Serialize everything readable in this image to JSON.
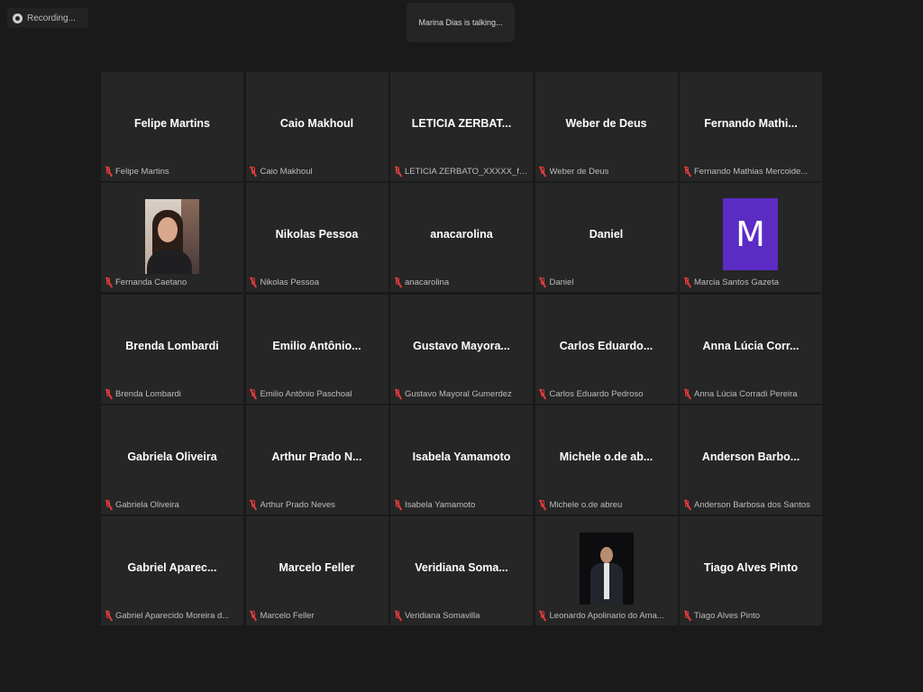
{
  "recording": {
    "label": "Recording...",
    "icon": "recording-icon"
  },
  "talking": {
    "text": "Marina Dias is talking..."
  },
  "colors": {
    "background": "#1a1a1a",
    "tile": "#262626",
    "mic_muted": "#e23b3b",
    "avatar_purple": "#5b2bc4"
  },
  "participants": [
    {
      "display": "Felipe Martins",
      "label": "Felipe Martins"
    },
    {
      "display": "Caio Makhoul",
      "label": "Caio Makhoul"
    },
    {
      "display": "LETICIA ZERBAT...",
      "label": "LETICIA ZERBATO_XXXXX_feli..."
    },
    {
      "display": "Weber de Deus",
      "label": "Weber de Deus"
    },
    {
      "display": "Fernando  Mathi...",
      "label": "Fernando Mathias Mercoide..."
    },
    {
      "display": "",
      "label": "Fernanda Caetano",
      "video": "photo-woman"
    },
    {
      "display": "Nikolas Pessoa",
      "label": "Nikolas Pessoa"
    },
    {
      "display": "anacarolina",
      "label": "anacarolina"
    },
    {
      "display": "Daniel",
      "label": "Daniel"
    },
    {
      "display": "",
      "label": "Marcia Santos Gazeta",
      "avatar": "M"
    },
    {
      "display": "Brenda Lombardi",
      "label": "Brenda Lombardi"
    },
    {
      "display": "Emilio  Antônio...",
      "label": "Emilio Antônio Paschoal"
    },
    {
      "display": "Gustavo  Mayora...",
      "label": "Gustavo Mayoral Gumerdez"
    },
    {
      "display": "Carlos  Eduardo...",
      "label": "Carlos Eduardo Pedroso"
    },
    {
      "display": "Anna Lúcia Corr...",
      "label": "Anna Lúcia Corradi Pereira"
    },
    {
      "display": "Gabriela Oliveira",
      "label": "Gabriela Oliveira"
    },
    {
      "display": "Arthur Prado N...",
      "label": "Arthur Prado Neves"
    },
    {
      "display": "Isabela Yamamoto",
      "label": "Isabela Yamamoto"
    },
    {
      "display": "Michele  o.de  ab...",
      "label": "Michele o.de abreu"
    },
    {
      "display": "Anderson  Barbo...",
      "label": "Anderson Barbosa dos Santos"
    },
    {
      "display": "Gabriel  Aparec...",
      "label": "Gabriel Aparecido Moreira d..."
    },
    {
      "display": "Marcelo Feller",
      "label": "Marcelo Feller"
    },
    {
      "display": "Veridiana  Soma...",
      "label": "Veridiana Somavilla"
    },
    {
      "display": "",
      "label": "Leonardo Apolinario do Ama...",
      "video": "photo-man"
    },
    {
      "display": "Tiago Alves Pinto",
      "label": "Tiago Alves Pinto"
    }
  ]
}
